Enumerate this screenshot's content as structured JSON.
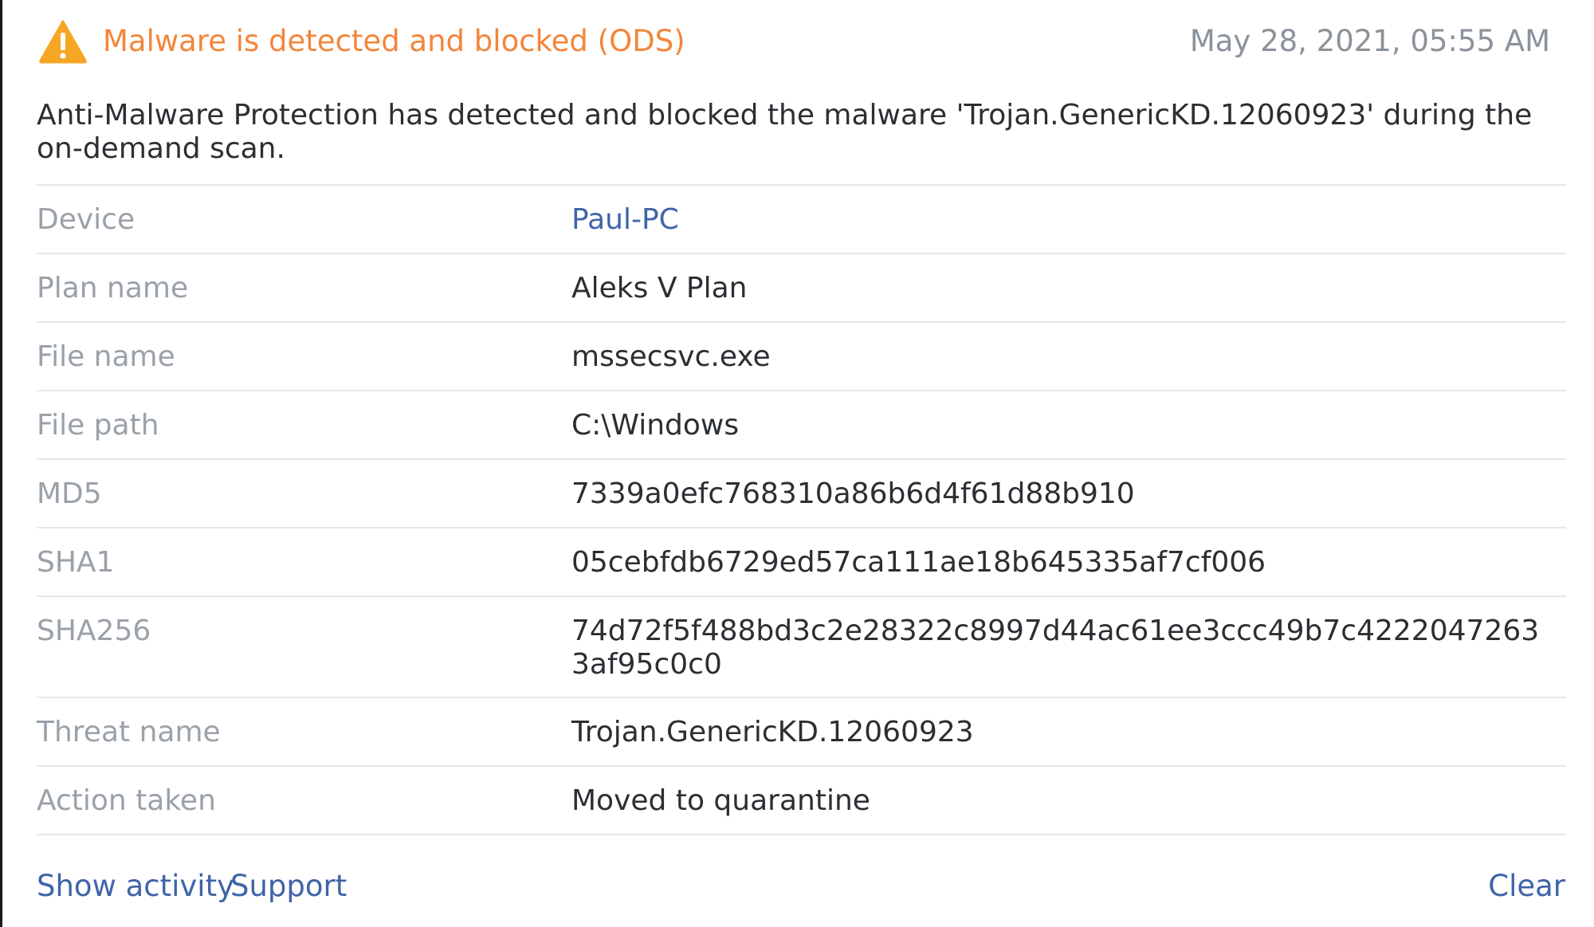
{
  "alert": {
    "icon": "warning-triangle-icon",
    "title": "Malware is detected and blocked (ODS)",
    "timestamp": "May 28, 2021, 05:55 AM",
    "title_color": "#f4853a",
    "icon_color": "#f5a623"
  },
  "description": "Anti-Malware Protection has detected and blocked the malware 'Trojan.GenericKD.12060923' during the on-demand scan.",
  "details": [
    {
      "label": "Device",
      "value": "Paul-PC",
      "is_link": true
    },
    {
      "label": "Plan name",
      "value": "Aleks V Plan"
    },
    {
      "label": "File name",
      "value": "mssecsvc.exe"
    },
    {
      "label": "File path",
      "value": "C:\\Windows"
    },
    {
      "label": "MD5",
      "value": "7339a0efc768310a86b6d4f61d88b910"
    },
    {
      "label": "SHA1",
      "value": "05cebfdb6729ed57ca111ae18b645335af7cf006"
    },
    {
      "label": "SHA256",
      "value": "74d72f5f488bd3c2e28322c8997d44ac61ee3ccc49b7c42220472633af95c0c0"
    },
    {
      "label": "Threat name",
      "value": "Trojan.GenericKD.12060923"
    },
    {
      "label": "Action taken",
      "value": "Moved to quarantine"
    }
  ],
  "footer": {
    "show_activity": "Show activity",
    "support": "Support",
    "clear": "Clear"
  },
  "link_color": "#3f64a8"
}
